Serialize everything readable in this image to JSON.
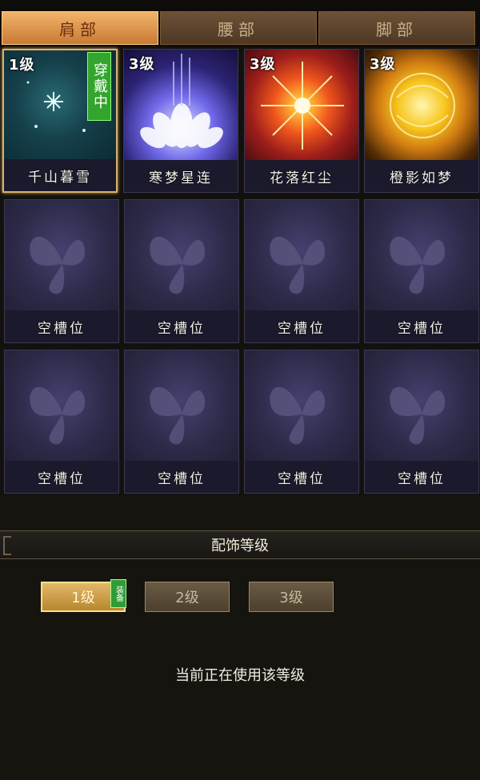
{
  "tabs": [
    {
      "label": "肩部",
      "active": true
    },
    {
      "label": "腰部",
      "active": false
    },
    {
      "label": "脚部",
      "active": false
    }
  ],
  "slots": [
    {
      "level": "1级",
      "name": "千山暮雪",
      "badge": "穿戴中",
      "art": "snow"
    },
    {
      "level": "3级",
      "name": "寒梦星连",
      "badge": "",
      "art": "lotus"
    },
    {
      "level": "3级",
      "name": "花落红尘",
      "badge": "",
      "art": "sun"
    },
    {
      "level": "3级",
      "name": "橙影如梦",
      "badge": "",
      "art": "gold"
    },
    {
      "level": "",
      "name": "空槽位",
      "badge": "",
      "art": "empty"
    },
    {
      "level": "",
      "name": "空槽位",
      "badge": "",
      "art": "empty"
    },
    {
      "level": "",
      "name": "空槽位",
      "badge": "",
      "art": "empty"
    },
    {
      "level": "",
      "name": "空槽位",
      "badge": "",
      "art": "empty"
    },
    {
      "level": "",
      "name": "空槽位",
      "badge": "",
      "art": "empty"
    },
    {
      "level": "",
      "name": "空槽位",
      "badge": "",
      "art": "empty"
    },
    {
      "level": "",
      "name": "空槽位",
      "badge": "",
      "art": "empty"
    },
    {
      "level": "",
      "name": "空槽位",
      "badge": "",
      "art": "empty"
    }
  ],
  "section": {
    "title": "配饰等级"
  },
  "level_buttons": [
    {
      "label": "1级",
      "active": true
    },
    {
      "label": "2级",
      "active": false
    },
    {
      "label": "3级",
      "active": false
    }
  ],
  "equip_tag": "装备",
  "status_text": "当前正在使用该等级",
  "colors": {
    "accent": "#d9b26a",
    "badge_green": "#33a52e"
  }
}
